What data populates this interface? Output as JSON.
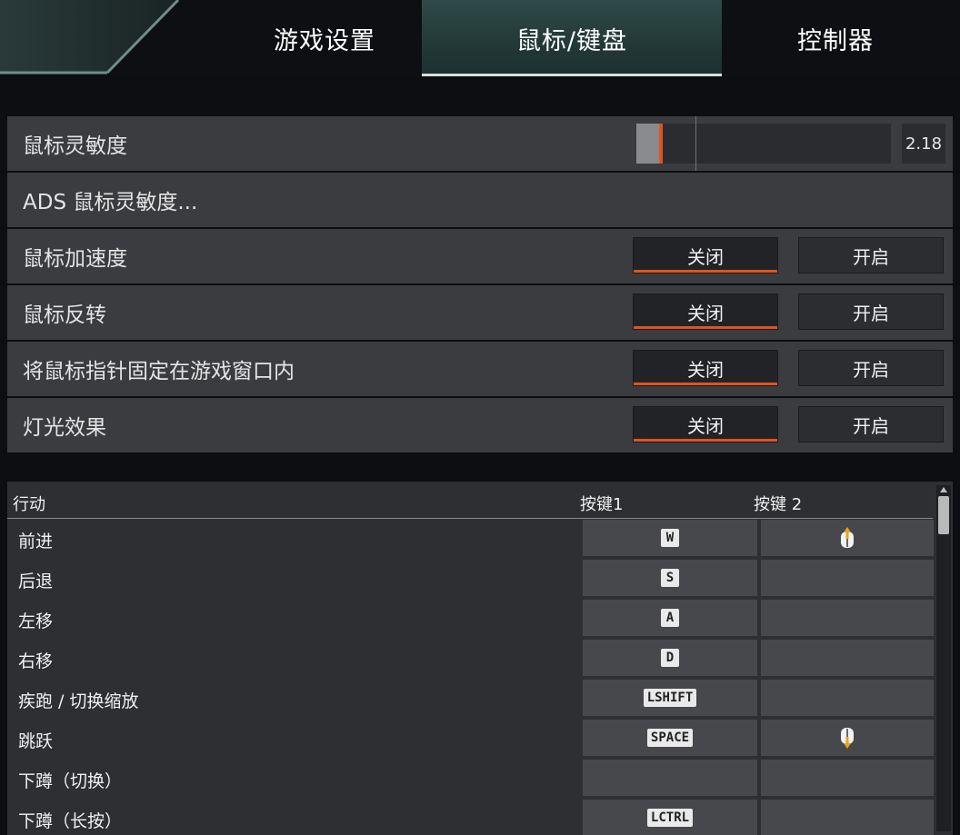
{
  "tabs": [
    {
      "label": "游戏设置",
      "active": false
    },
    {
      "label": "鼠标/键盘",
      "active": true
    },
    {
      "label": "控制器",
      "active": false
    }
  ],
  "settings": {
    "sensitivity": {
      "label": "鼠标灵敏度",
      "value": "2.18",
      "level": 0.09
    },
    "ads": {
      "label": "ADS 鼠标灵敏度..."
    },
    "toggles": [
      {
        "label": "鼠标加速度",
        "off": "关闭",
        "on": "开启",
        "selected": "off"
      },
      {
        "label": "鼠标反转",
        "off": "关闭",
        "on": "开启",
        "selected": "off"
      },
      {
        "label": "将鼠标指针固定在游戏窗口内",
        "off": "关闭",
        "on": "开启",
        "selected": "off"
      },
      {
        "label": "灯光效果",
        "off": "关闭",
        "on": "开启",
        "selected": "off"
      }
    ]
  },
  "keybinds": {
    "headers": {
      "action": "行动",
      "key1": "按键1",
      "key2": "按键 2"
    },
    "rows": [
      {
        "action": "前进",
        "key1": "W",
        "key2_icon": "mouse-wheel-up-icon"
      },
      {
        "action": "后退",
        "key1": "S"
      },
      {
        "action": "左移",
        "key1": "A"
      },
      {
        "action": "右移",
        "key1": "D"
      },
      {
        "action": "疾跑 / 切换缩放",
        "key1": "LSHIFT"
      },
      {
        "action": "跳跃",
        "key1": "SPACE",
        "key2_icon": "mouse-wheel-down-icon"
      },
      {
        "action": "下蹲（切换）",
        "key1": ""
      },
      {
        "action": "下蹲（长按）",
        "key1": "LCTRL"
      }
    ]
  },
  "colors": {
    "accent": "#e0541e",
    "active_tab": "#223836",
    "row_bg": "#3b3c40"
  }
}
